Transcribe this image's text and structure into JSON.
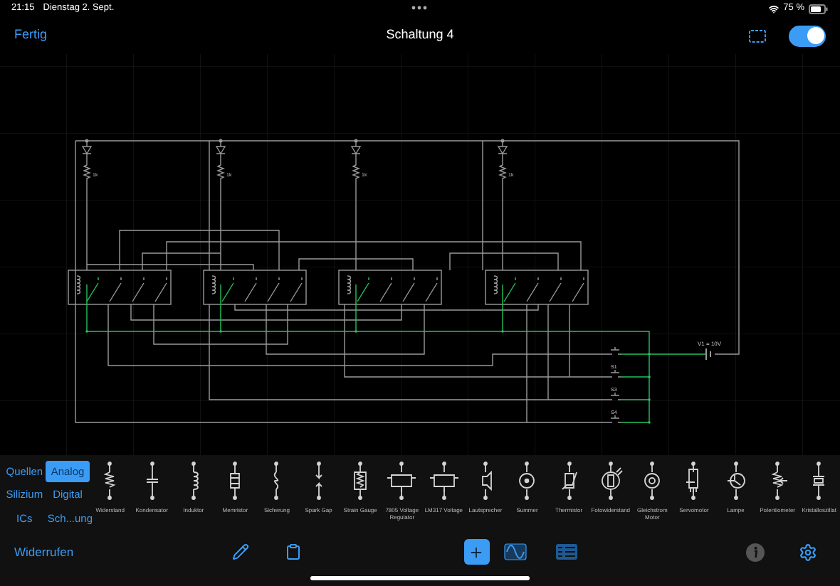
{
  "status_bar": {
    "time": "21:15",
    "date": "Dienstag 2. Sept.",
    "battery": "75 %"
  },
  "nav": {
    "done": "Fertig",
    "title": "Schaltung 4",
    "toggle_on": true
  },
  "circuit": {
    "resistor_labels": [
      "1k",
      "1k",
      "1k",
      "1k"
    ],
    "source_label": "V1 = 10V",
    "switch_labels": [
      "S1",
      "S3",
      "S4"
    ]
  },
  "categories": [
    {
      "label": "Quellen",
      "selected": false
    },
    {
      "label": "Analog",
      "selected": true
    },
    {
      "label": "Silizium",
      "selected": false
    },
    {
      "label": "Digital",
      "selected": false
    },
    {
      "label": "ICs",
      "selected": false
    },
    {
      "label": "Sch...ung",
      "selected": false
    }
  ],
  "components": [
    {
      "label": "Widerstand",
      "kind": "resistor"
    },
    {
      "label": "Kondensator",
      "kind": "capacitor"
    },
    {
      "label": "Induktor",
      "kind": "inductor"
    },
    {
      "label": "Memristor",
      "kind": "memristor"
    },
    {
      "label": "Sicherung",
      "kind": "fuse"
    },
    {
      "label": "Spark Gap",
      "kind": "sparkgap"
    },
    {
      "label": "Strain Gauge",
      "kind": "straingauge"
    },
    {
      "label": "7805 Voltage Regulator",
      "kind": "regulator"
    },
    {
      "label": "LM317 Voltage",
      "kind": "regulator"
    },
    {
      "label": "Lautsprecher",
      "kind": "speaker"
    },
    {
      "label": "Summer",
      "kind": "buzzer"
    },
    {
      "label": "Thermistor",
      "kind": "thermistor"
    },
    {
      "label": "Fotowiderstand",
      "kind": "photoresistor"
    },
    {
      "label": "Gleichstrom Motor",
      "kind": "motor"
    },
    {
      "label": "Servomotor",
      "kind": "servo"
    },
    {
      "label": "Lampe",
      "kind": "lamp"
    },
    {
      "label": "Potentiometer",
      "kind": "potentiometer"
    },
    {
      "label": "Kristalloszillat",
      "kind": "crystal"
    }
  ],
  "toolbar": {
    "undo": "Widerrufen"
  }
}
